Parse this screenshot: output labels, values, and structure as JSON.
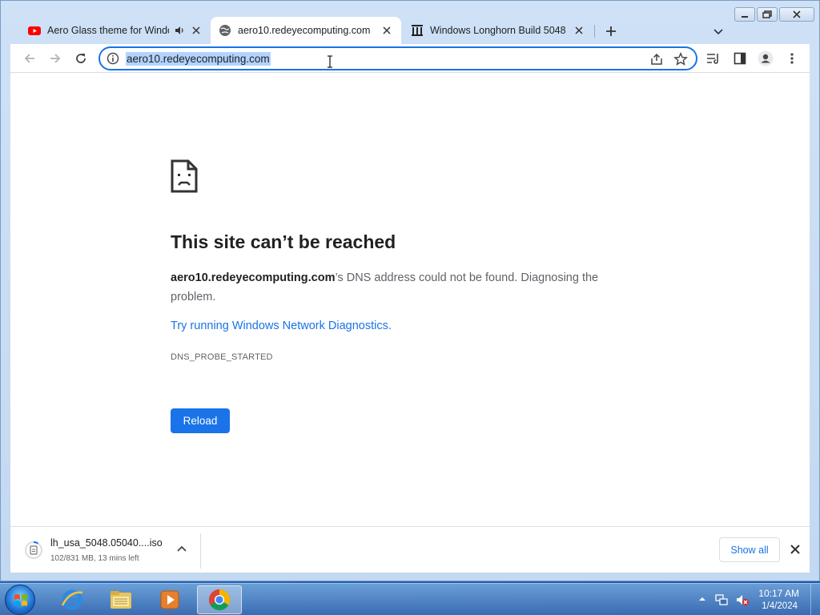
{
  "window": {
    "controls": [
      "minimize",
      "maximize",
      "close"
    ]
  },
  "tabs": [
    {
      "title": "Aero Glass theme for Windo",
      "favicon": "youtube-icon",
      "audio": true,
      "active": false
    },
    {
      "title": "aero10.redeyecomputing.com",
      "favicon": "globe-icon",
      "active": true
    },
    {
      "title": "Windows Longhorn Build 5048 :",
      "favicon": "archive-icon",
      "active": false
    }
  ],
  "omnibox": {
    "url": "aero10.redeyecomputing.com"
  },
  "error": {
    "title": "This site can’t be reached",
    "host": "aero10.redeyecomputing.com",
    "message": "’s DNS address could not be found. Diagnosing the problem.",
    "link": "Try running Windows Network Diagnostics.",
    "code": "DNS_PROBE_STARTED",
    "reload_label": "Reload"
  },
  "download": {
    "filename": "lh_usa_5048.05040....iso",
    "status": "102/831 MB, 13 mins left",
    "show_all_label": "Show all"
  },
  "taskbar": {
    "apps": [
      "internet-explorer-icon",
      "file-explorer-icon",
      "media-player-icon",
      "chrome-icon"
    ],
    "time": "10:17 AM",
    "date": "1/4/2024"
  },
  "colors": {
    "accent": "#1a73e8",
    "selection": "#b3d3ff"
  }
}
